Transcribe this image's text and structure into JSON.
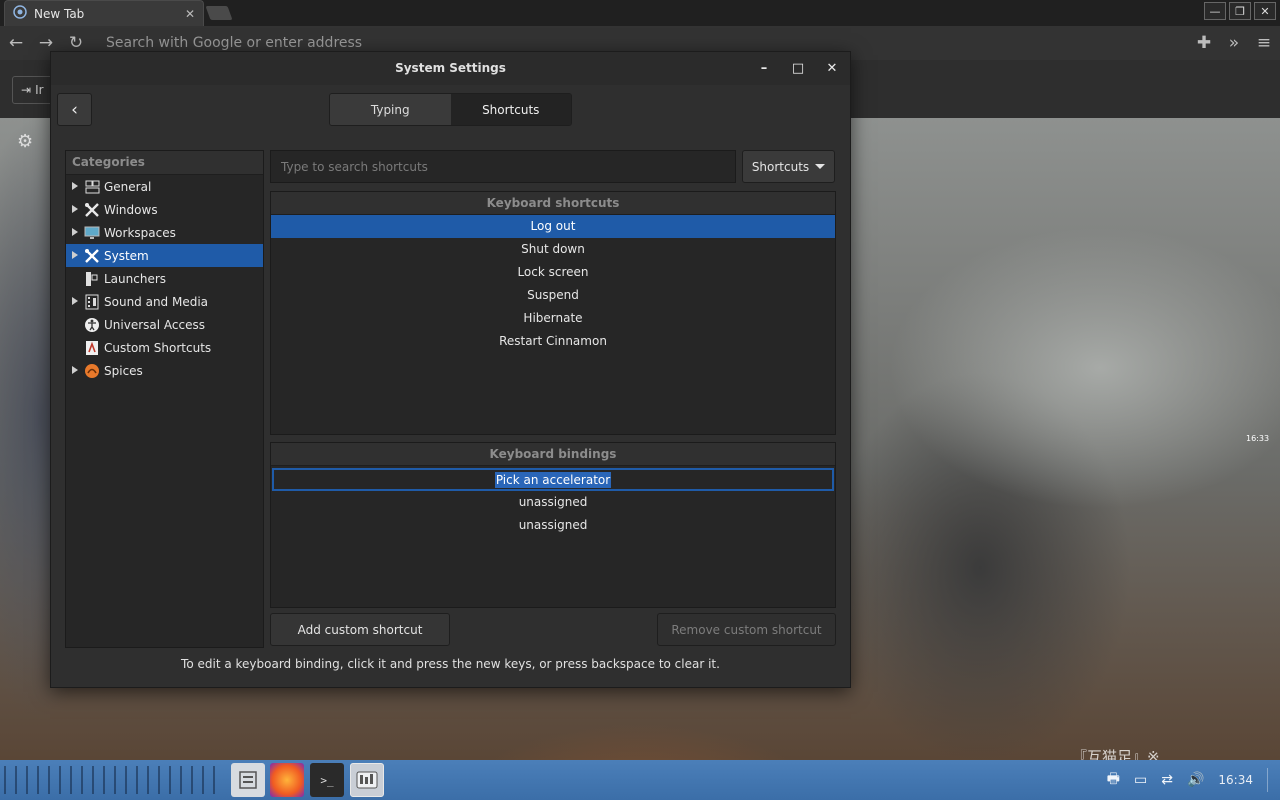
{
  "browser": {
    "tab_title": "New Tab",
    "tab_close": "✕",
    "url_placeholder": "Search with Google or enter address",
    "bookmark_label": "Ir",
    "window_buttons": [
      "—",
      "❐",
      "✕"
    ],
    "nav_icons": [
      "back-icon",
      "forward-icon",
      "reload-icon"
    ]
  },
  "background_content": {
    "camera_time": "16:33",
    "caption": "『互猫足』※…"
  },
  "dialog": {
    "title": "System Settings",
    "controls": {
      "minimize": "–",
      "maximize": "□",
      "close": "✕"
    },
    "back": "‹",
    "tabs": [
      {
        "label": "Typing",
        "active": false
      },
      {
        "label": "Shortcuts",
        "active": true
      }
    ],
    "categories": {
      "header": "Categories",
      "items": [
        {
          "label": "General",
          "expandable": true,
          "selected": false,
          "icon": "general-icon"
        },
        {
          "label": "Windows",
          "expandable": true,
          "selected": false,
          "icon": "windows-icon"
        },
        {
          "label": "Workspaces",
          "expandable": true,
          "selected": false,
          "icon": "workspaces-icon"
        },
        {
          "label": "System",
          "expandable": true,
          "selected": true,
          "icon": "system-icon"
        },
        {
          "label": "Launchers",
          "expandable": false,
          "selected": false,
          "icon": "launchers-icon"
        },
        {
          "label": "Sound and Media",
          "expandable": true,
          "selected": false,
          "icon": "sound-media-icon"
        },
        {
          "label": "Universal Access",
          "expandable": false,
          "selected": false,
          "icon": "universal-access-icon"
        },
        {
          "label": "Custom Shortcuts",
          "expandable": false,
          "selected": false,
          "icon": "custom-shortcuts-icon"
        },
        {
          "label": "Spices",
          "expandable": true,
          "selected": false,
          "icon": "spices-icon"
        }
      ]
    },
    "search": {
      "placeholder": "Type to search shortcuts",
      "value": ""
    },
    "dropdown": {
      "label": "Shortcuts"
    },
    "shortcuts": {
      "header": "Keyboard shortcuts",
      "items": [
        "Log out",
        "Shut down",
        "Lock screen",
        "Suspend",
        "Hibernate",
        "Restart Cinnamon"
      ],
      "selected_index": 0
    },
    "bindings": {
      "header": "Keyboard bindings",
      "editing_prompt": "Pick an accelerator",
      "items": [
        "unassigned",
        "unassigned"
      ]
    },
    "buttons": {
      "add": "Add custom shortcut",
      "remove": "Remove custom shortcut"
    },
    "hint": "To edit a keyboard binding, click it and press the new keys, or press backspace to clear it."
  },
  "taskbar": {
    "apps": [
      "files-icon",
      "firefox-icon",
      "terminal-icon",
      "system-settings-icon"
    ],
    "terminal_glyph": ">_",
    "tray_icons": [
      "printer-icon",
      "display-icon",
      "network-icon",
      "volume-icon"
    ],
    "clock": "16:34"
  },
  "colors": {
    "selection": "#1f5ba8",
    "dialog_bg": "#2f2f2f",
    "list_bg": "#262626",
    "taskbar": "#4b7fb9"
  }
}
